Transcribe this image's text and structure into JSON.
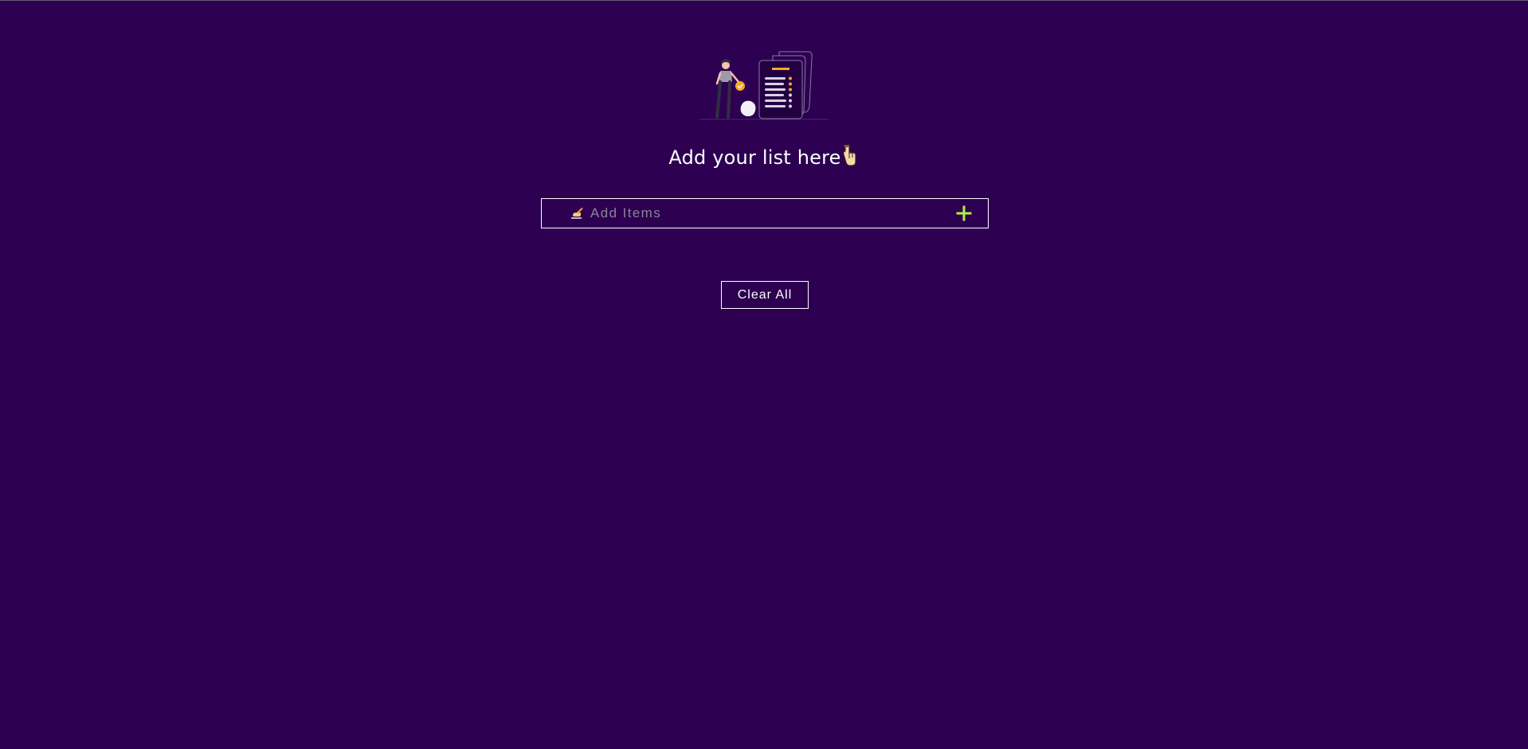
{
  "header": {
    "illustration_icon": "todo-list-illustration",
    "heading_text": "Add your list here",
    "heading_emoji_icon": "pointing-hand-icon"
  },
  "add_item": {
    "placeholder": "Add Items",
    "value": "",
    "leading_icon": "writing-hand-icon",
    "add_icon": "plus-icon"
  },
  "actions": {
    "clear_all_label": "Clear All"
  },
  "colors": {
    "background": "#2d0052",
    "text": "#ffffff",
    "accent_plus": "#b4f03c",
    "accent_orange": "#f9a826",
    "placeholder": "#8d8397"
  }
}
